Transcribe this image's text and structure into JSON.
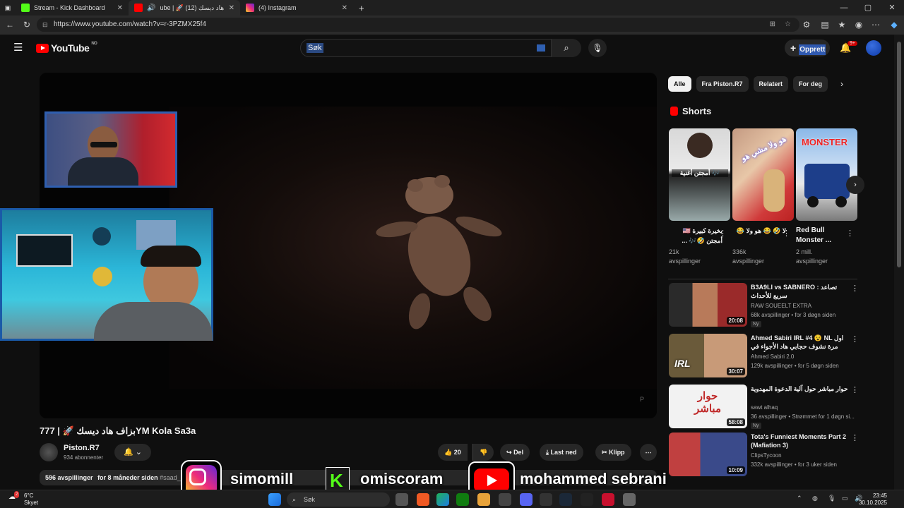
{
  "browser": {
    "tabs": [
      {
        "label": "Stream - Kick Dashboard",
        "active": false
      },
      {
        "label": "ube | 🚀 بزاف هاد ديسك (12)",
        "active": true
      },
      {
        "label": "(4) Instagram",
        "active": false
      }
    ],
    "url": "https://www.youtube.com/watch?v=r-3PZMX25f4"
  },
  "youtube": {
    "logo_text": "YouTube",
    "region": "NO",
    "search_query": "Søk",
    "create_label": "Opprett",
    "notifications": "9+"
  },
  "video": {
    "title": "777 | 🚀 بزاف هاد ديسكYM Kola Sa3a",
    "channel": "Piston.R7",
    "subscribers": "934 abonnenter",
    "likes": "20",
    "share_label": "Del",
    "download_label": "Last ned",
    "clip_label": "Klipp",
    "views": "596 avspillinger",
    "age": "for 8 måneder siden",
    "hashtag": "#saad_",
    "watermark": "P"
  },
  "overlay": {
    "instagram_handle": "simomill",
    "kick_handle": "omiscoram",
    "youtube_handle": "mohammed sebrani"
  },
  "sidebar": {
    "chips": [
      "Alle",
      "Fra Piston.R7",
      "Relatert",
      "For deg"
    ],
    "shorts_heading": "Shorts",
    "shorts": [
      {
        "title": "بخيرة كبيرة 🇺🇸 أمجتن 🤣🎶 ...",
        "views": "21k",
        "views_label": "avspillinger",
        "thumb_text": "أمجتن أغنية 🎶"
      },
      {
        "title": "لا 🤣 😂 هو ولا 😂",
        "views": "336k",
        "views_label": "avspillinger",
        "thumb_text": "هو ولا مشي هو"
      },
      {
        "title": "Red Bull Monster ...",
        "views": "2 mill.",
        "views_label": "avspillinger",
        "thumb_text": "MONSTER"
      }
    ],
    "videos": [
      {
        "title": "B3A9LI vs SABNERO : تصاعد سريع للأحداث",
        "channel": "RAW SOUEELT EXTRA",
        "meta": "68k avspillinger • for 3 døgn siden",
        "duration": "20:08",
        "new": "Ny"
      },
      {
        "title": "Ahmed Sabiri IRL #4 😵 NL اول مرة نشوف حجابي هاد الأجواء في أوروبا ...",
        "channel": "Ahmed Sabiri 2.0",
        "meta": "129k avspillinger • for 5 døgn siden",
        "duration": "30:07",
        "new": "",
        "thumb_text": "IRL"
      },
      {
        "title": "حوار مباشر حول آلية الدعوة المهدوية",
        "channel": "sawt alhaq",
        "meta": "36 avspillinger • Strømmet for 1 døgn si...",
        "duration": "58:08",
        "new": "Ny",
        "thumb_text": "حوار مباشر"
      },
      {
        "title": "Tota's Funniest Moments Part 2 (Mafiation 3)",
        "channel": "ClipsTycoon",
        "meta": "332k avspillinger • for 3 uker siden",
        "duration": "10:09",
        "new": ""
      }
    ]
  },
  "taskbar": {
    "temp": "6°C",
    "weather": "Skyet",
    "weather_badge": "2",
    "search": "Søk",
    "time": "23:45",
    "date": "30.10.2025"
  },
  "colors": {
    "accent": "#ff0000",
    "kick": "#53fc18",
    "background": "#0f0f0f"
  }
}
